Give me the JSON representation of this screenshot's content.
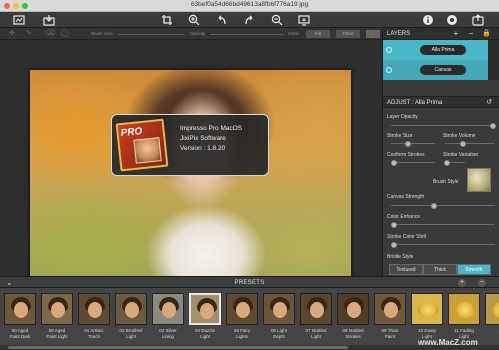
{
  "window": {
    "title": "63bef0a54d66bd49613a8fb6f776a19.jpg",
    "traffic_light_colors": [
      "#ff5f57",
      "#febc2e",
      "#28c840"
    ]
  },
  "toolbar": {
    "left_icons": [
      "compare-view-icon",
      "open-image-icon"
    ],
    "center_icons": [
      "crop-icon",
      "zoom-in-icon",
      "rotate-left-icon",
      "rotate-right-icon",
      "zoom-out-icon",
      "fit-screen-icon"
    ],
    "right_icons": [
      "info-icon",
      "settings-icon",
      "export-icon"
    ]
  },
  "brushbar": {
    "brush_size_label": "Brush Size",
    "opacity_label": "Opacity",
    "mask_label": "Mask",
    "fill_label": "Fill",
    "clear_label": "Clear"
  },
  "about": {
    "badge": "PRO",
    "line1": "Impresso Pro MacOS",
    "line2": "JixiPix Software",
    "line3": "Version : 1.8.20"
  },
  "layers": {
    "title": "LAYERS",
    "items": [
      {
        "label": "Alla Prima"
      },
      {
        "label": "Canvas"
      }
    ]
  },
  "adjust": {
    "title": "ADJUST : Alla Prima",
    "layer_opacity": "Layer Opacity",
    "stroke_size": "Stroke Size",
    "stroke_volume": "Stroke Volume",
    "conform_strokes": "Conform Strokes",
    "stroke_variation": "Stroke Variation",
    "brush_style": "Brush Style",
    "canvas_strength": "Canvas Strength",
    "color_enhance": "Color Enhance",
    "stroke_color_shift": "Stroke Color Shift",
    "bristle_style": "Bristle Style",
    "bristle_options": [
      "Textured",
      "Thick",
      "Smooth"
    ],
    "bristle_selected": "Smooth",
    "accent": "#4ab7c9"
  },
  "presets": {
    "title": "PRESETS",
    "items": [
      {
        "line1": "00 Aged",
        "line2": "Paint Dark"
      },
      {
        "line1": "00 Aged",
        "line2": "Paint Light"
      },
      {
        "line1": "01 Artistic",
        "line2": "Touch"
      },
      {
        "line1": "02 Brushed",
        "line2": "Light"
      },
      {
        "line1": "03 Silver",
        "line2": "Lining"
      },
      {
        "line1": "04 Dazzle",
        "line2": "Light"
      },
      {
        "line1": "05 Fairy",
        "line2": "Lights"
      },
      {
        "line1": "06 Light",
        "line2": "Depth"
      },
      {
        "line1": "07 Mottled",
        "line2": "Light"
      },
      {
        "line1": "08 Mottled",
        "line2": "Strokes"
      },
      {
        "line1": "09 Thick",
        "line2": "Paint"
      },
      {
        "line1": "10 Dusty",
        "line2": "Light"
      },
      {
        "line1": "11 Fading",
        "line2": "Light"
      },
      {
        "line1": "12",
        "line2": ""
      }
    ],
    "selected_index": 5
  },
  "watermark": "www.MacZ.com"
}
